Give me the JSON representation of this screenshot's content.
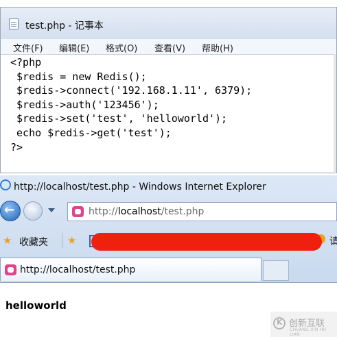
{
  "notepad": {
    "title": "test.php - 记事本",
    "menu": [
      "文件(F)",
      "编辑(E)",
      "格式(O)",
      "查看(V)",
      "帮助(H)"
    ],
    "code": "<?php\n $redis = new Redis();\n $redis->connect('192.168.1.11', 6379);\n $redis->auth('123456');\n $redis->set('test', 'helloworld');\n echo $redis->get('test');\n?>"
  },
  "browser": {
    "title": "http://localhost/test.php - Windows Internet Explorer",
    "address_prefix": "http://",
    "address_host": "localhost",
    "address_path": "/test.php",
    "favorites_label": "收藏夹",
    "favorites_tail": "请",
    "tab_label": "http://localhost/test.php"
  },
  "page": {
    "output": "helloworld"
  },
  "watermark": {
    "text": "创新互联",
    "subtext": "CHUANG XIN HU LIAN"
  }
}
